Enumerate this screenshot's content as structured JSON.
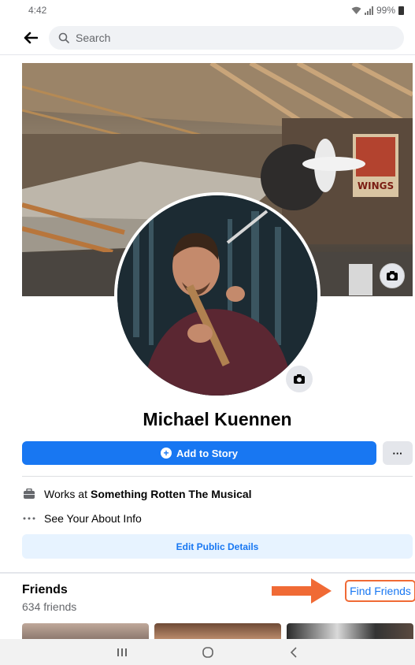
{
  "status_bar": {
    "time": "4:42",
    "battery": "99%"
  },
  "search": {
    "placeholder": "Search"
  },
  "profile": {
    "name": "Michael Kuennen"
  },
  "actions": {
    "add_story_label": "Add to Story",
    "more_label": "···"
  },
  "about": {
    "works_prefix": "Works at",
    "works_employer": "Something Rotten The Musical",
    "see_about": "See Your About Info",
    "edit_details": "Edit Public Details"
  },
  "cover": {
    "poster_text": "WINGS"
  },
  "friends": {
    "title": "Friends",
    "count": "634 friends",
    "find_friends": "Find Friends"
  },
  "annotation": {
    "arrow_color": "#f06a35"
  },
  "colors": {
    "accent": "#1877f2",
    "annotation": "#f06a35"
  },
  "nav": {
    "recents_icon": "recents-icon",
    "home_icon": "home-icon",
    "back_icon": "back-icon"
  }
}
